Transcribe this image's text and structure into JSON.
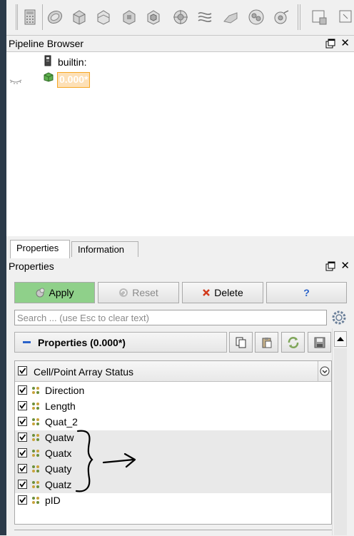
{
  "pipeline_browser": {
    "title": "Pipeline Browser",
    "server_label": "builtin:",
    "source_label": "0.000*"
  },
  "tabs": [
    {
      "label": "Properties"
    },
    {
      "label": "Information"
    }
  ],
  "properties_panel": {
    "title": "Properties",
    "apply_label": "Apply",
    "reset_label": "Reset",
    "delete_label": "Delete",
    "help_label": "?",
    "search_placeholder": "Search ... (use Esc to clear text)",
    "section_title": "Properties (0.000*)"
  },
  "array_status": {
    "header_label": "Cell/Point Array Status",
    "rows": [
      {
        "label": "Direction",
        "checked": true,
        "highlighted": false
      },
      {
        "label": "Length",
        "checked": true,
        "highlighted": false
      },
      {
        "label": "Quat_2",
        "checked": true,
        "highlighted": false
      },
      {
        "label": "Quatw",
        "checked": true,
        "highlighted": true
      },
      {
        "label": "Quatx",
        "checked": true,
        "highlighted": true
      },
      {
        "label": "Quaty",
        "checked": true,
        "highlighted": true
      },
      {
        "label": "Quatz",
        "checked": true,
        "highlighted": true
      },
      {
        "label": "pID",
        "checked": true,
        "highlighted": false
      }
    ]
  },
  "colors": {
    "apply_green": "#8fd08a",
    "selection_orange": "#f5a623",
    "left_strip": "#2b3a49"
  },
  "icons": {
    "toolbar": [
      "calculator-icon",
      "contour-icon",
      "clip-icon",
      "slice-icon",
      "threshold-icon",
      "extract-subset-icon",
      "glyph-icon",
      "stream-tracer-icon",
      "warp-by-vector-icon",
      "group-datasets-icon",
      "extract-level-icon",
      "selection-display-icon",
      "toggle-icon"
    ]
  }
}
